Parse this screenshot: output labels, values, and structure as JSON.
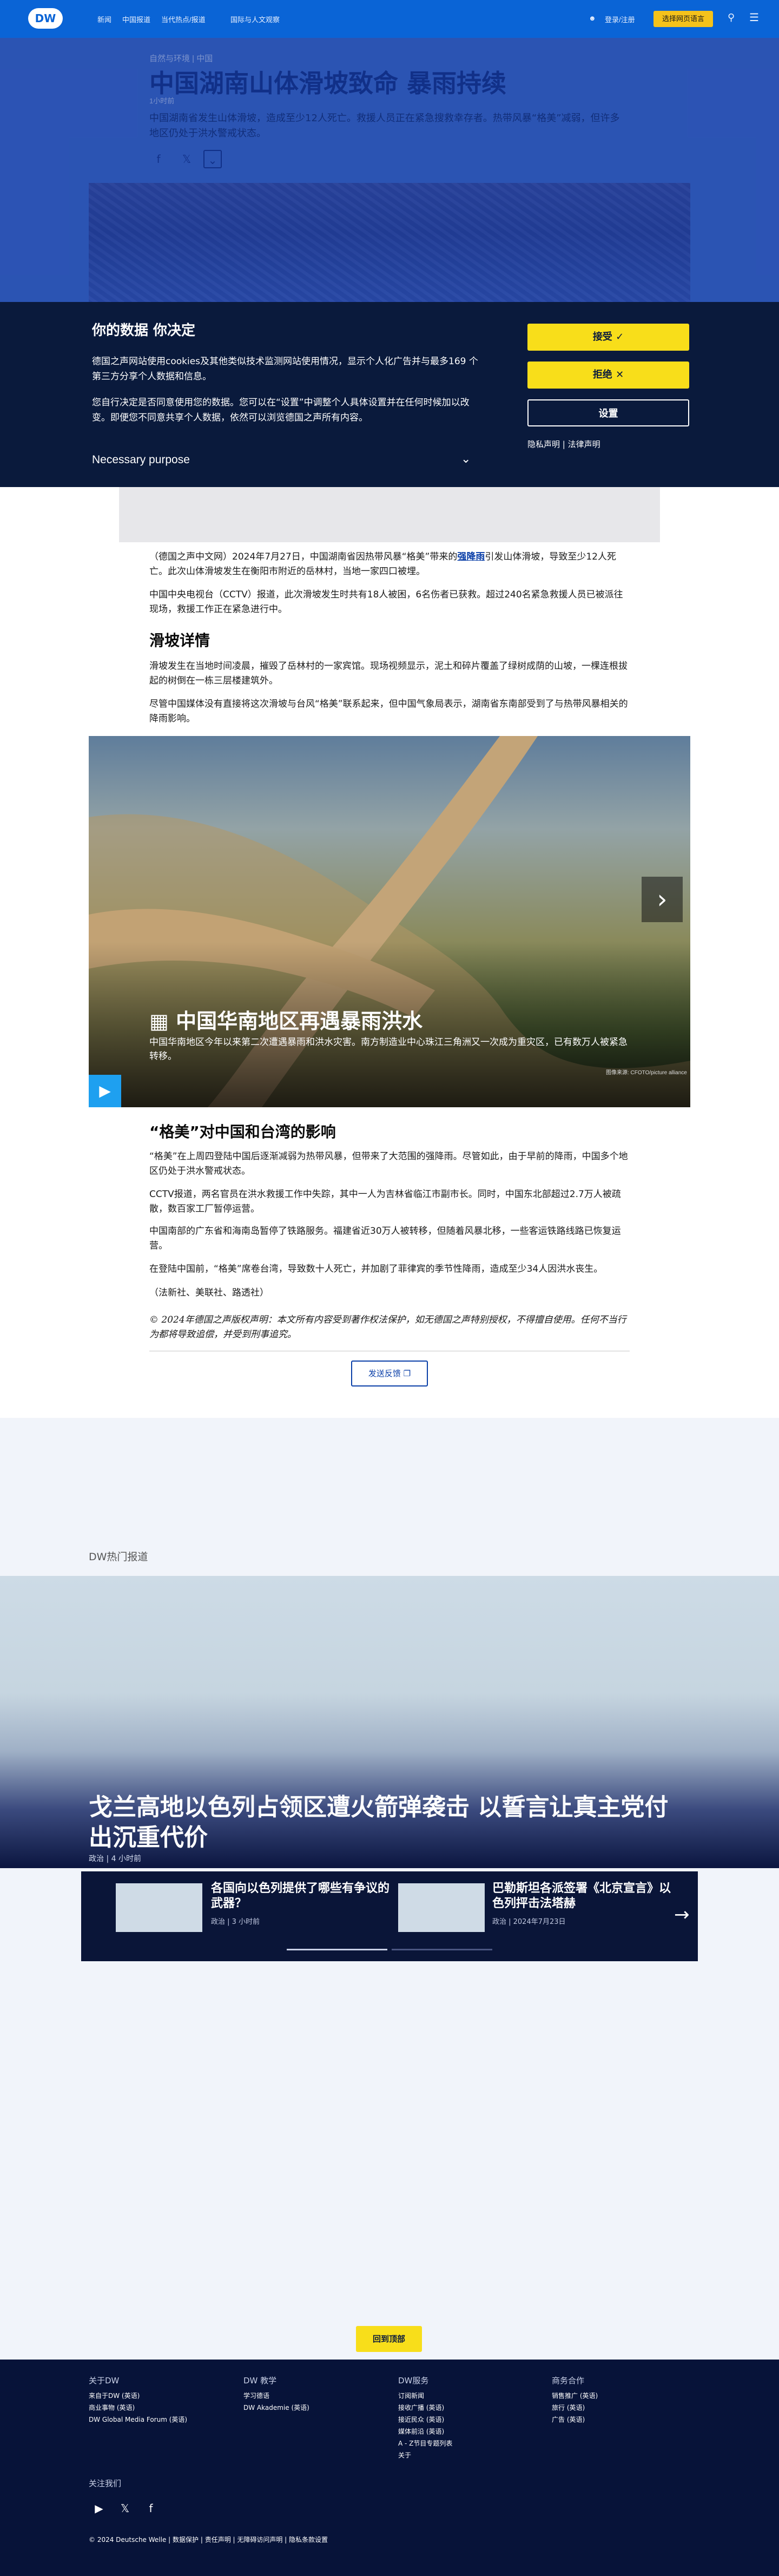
{
  "header": {
    "logo_text": "DW",
    "nav": [
      "新闻",
      "中国报道",
      "当代热点/报道",
      "国际与人文观察"
    ],
    "login_label": "登录/注册",
    "lang_button": "选择网页语言",
    "colors": {
      "brand": "#0a64d6",
      "accent": "#f5c21b"
    }
  },
  "article": {
    "kicker": "自然与环境 | 中国",
    "time": "1小时前",
    "title": "中国湖南山体滑坡致命 暴雨持续",
    "lead": "中国湖南省发生山体滑坡，造成至少12人死亡。救援人员正在紧急搜救幸存者。热带风暴“格美”减弱，但许多地区仍处于洪水警戒状态。",
    "share_icons": [
      "facebook-icon",
      "x-icon",
      "more-icon"
    ],
    "paragraphs": {
      "p1_before": "（德国之声中文网）2024年7月27日，中国湖南省因热带风暴“格美”带来的",
      "p1_link": "强降雨",
      "p1_after": "引发山体滑坡，导致至少12人死亡。此次山体滑坡发生在衡阳市附近的岳林村，当地一家四口被埋。",
      "p2": "中国中央电视台（CCTV）报道，此次滑坡发生时共有18人被困，6名伤者已获救。超过240名紧急救援人员已被派往现场，救援工作正在紧急进行中。",
      "h_details": "滑坡详情",
      "p3": "滑坡发生在当地时间凌晨，摧毁了岳林村的一家宾馆。现场视频显示，泥土和碎片覆盖了绿树成荫的山坡，一棵连根拔起的树倒在一栋三层楼建筑外。",
      "p4": "尽管中国媒体没有直接将这次滑坡与台风“格美”联系起来，但中国气象局表示，湖南省东南部受到了与热带风暴相关的降雨影响。",
      "h_impact": "“格美”对中国和台湾的影响",
      "p5": "“格美”在上周四登陆中国后逐渐减弱为热带风暴，但带来了大范围的强降雨。尽管如此，由于早前的降雨，中国多个地区仍处于洪水警戒状态。",
      "p6": "CCTV报道，两名官员在洪水救援工作中失踪，其中一人为吉林省临江市副市长。同时，中国东北部超过2.7万人被疏散，数百家工厂暂停运营。",
      "p7": "中国南部的广东省和海南岛暂停了铁路服务。福建省近30万人被转移，但随着风暴北移，一些客运铁路线路已恢复运营。",
      "p8": "在登陆中国前，“格美”席卷台湾，导致数十人死亡，并加剧了菲律宾的季节性降雨，造成至少34人因洪水丧生。",
      "p9": "（法新社、美联社、路透社）",
      "copyright": "© 2024年德国之声版权声明：本文所有内容受到著作权法保护，如无德国之声特别授权，不得擅自使用。任何不当行为都将导致追偿，并受到刑事追究。"
    },
    "feedback_label": "发送反馈"
  },
  "cookie": {
    "title": "你的数据 你决定",
    "p1": "德国之声网站使用cookies及其他类似技术监测网站使用情况，显示个人化广告并与最多169 个 第三方分享个人数据和信息。",
    "p2": "您自行决定是否同意使用您的数据。您可以在“设置”中调整个人具体设置并在任何时候加以改变。即便您不同意共享个人数据，依然可以浏览德国之声所有内容。",
    "purpose": "Necessary purpose",
    "accept": "接受",
    "reject": "拒绝",
    "settings": "设置",
    "links": "隐私声明 | 法律声明"
  },
  "gallery": {
    "title": "中国华南地区再遇暴雨洪水",
    "caption": "中国华南地区今年以来第二次遭遇暴雨和洪水灾害。南方制造业中心珠江三角洲又一次成为重灾区，已有数万人被紧急转移。",
    "credit": "图像来源: CFOTO/picture alliance"
  },
  "hot": {
    "section_label": "DW热门报道",
    "headline": "戈兰高地以色列占领区遭火箭弹袭击 以誓言让真主党付出沉重代价",
    "headline_meta": "政治 | 4 小时前",
    "cards": [
      {
        "title": "各国向以色列提供了哪些有争议的武器？",
        "meta": "政治 | 3 小时前"
      },
      {
        "title": "巴勒斯坦各派签署《北京宣言》以色列抨击法塔赫",
        "meta": "政治 | 2024年7月23日"
      }
    ],
    "top_button": "回到顶部"
  },
  "footer": {
    "columns": [
      {
        "head": "关于DW",
        "items": [
          "来自于DW (英语)",
          "商业事物 (英语)",
          "DW Global Media Forum (英语)"
        ]
      },
      {
        "head": "DW 教学",
        "items": [
          "学习德语",
          "DW Akademie (英语)"
        ]
      },
      {
        "head": "DW服务",
        "items": [
          "订阅新闻",
          "接收广播 (英语)",
          "接近民众 (英语)",
          "媒体前沿 (英语)",
          "A - Z节目专题列表",
          "关于"
        ]
      },
      {
        "head": "商务合作",
        "items": [
          "销售推广 (英语)",
          "旅行 (英语)",
          "广告 (英语)"
        ]
      }
    ],
    "follow": "关注我们",
    "social": [
      "youtube-icon",
      "x-icon",
      "facebook-icon"
    ],
    "bottom": "© 2024 Deutsche Welle  |  数据保护  |  责任声明  |  无障碍访问声明  |  隐私条款设置"
  }
}
